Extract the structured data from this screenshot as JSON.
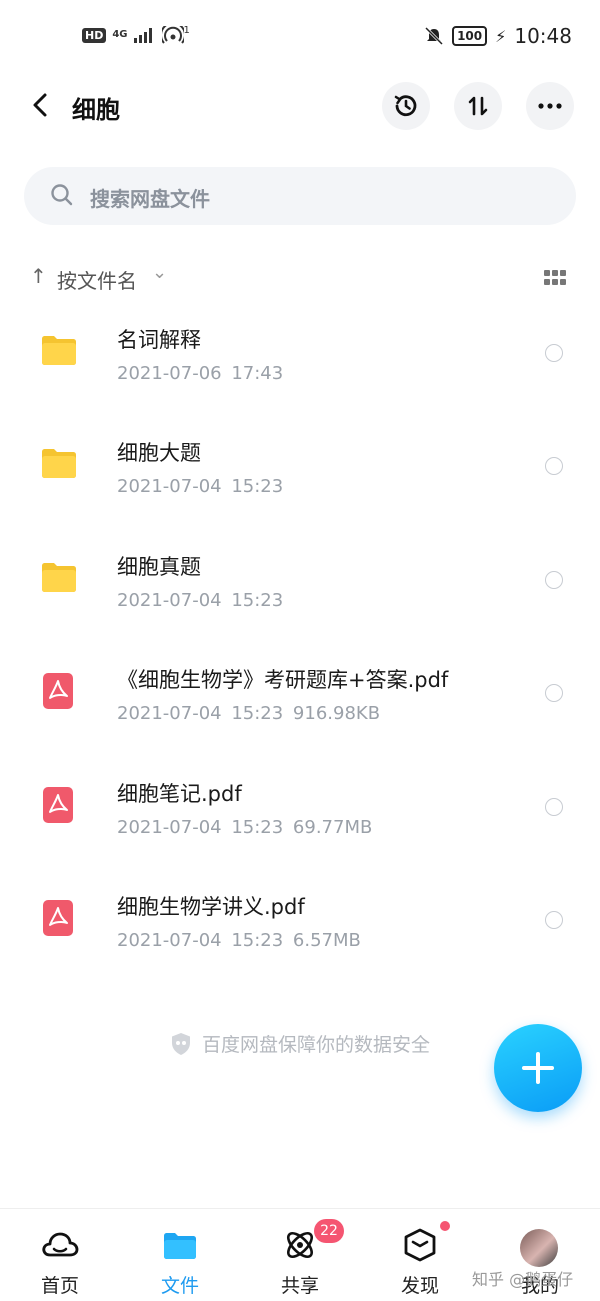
{
  "status_bar": {
    "left_hd": "HD",
    "left_net": "4G",
    "left_hotspot_sup": "1",
    "battery": "100",
    "time": "10:48"
  },
  "header": {
    "title": "细胞"
  },
  "search": {
    "placeholder": "搜索网盘文件"
  },
  "sort": {
    "label": "按文件名"
  },
  "files": [
    {
      "type": "folder",
      "name": "名词解释",
      "meta": "2021-07-06 17:43"
    },
    {
      "type": "folder",
      "name": "细胞大题",
      "meta": "2021-07-04 15:23"
    },
    {
      "type": "folder",
      "name": "细胞真题",
      "meta": "2021-07-04 15:23"
    },
    {
      "type": "pdf",
      "name": "《细胞生物学》考研题库+答案.pdf",
      "meta": "2021-07-04 15:23 916.98KB"
    },
    {
      "type": "pdf",
      "name": "细胞笔记.pdf",
      "meta": "2021-07-04 15:23 69.77MB"
    },
    {
      "type": "pdf",
      "name": "细胞生物学讲义.pdf",
      "meta": "2021-07-04 15:23 6.57MB"
    }
  ],
  "security_text": "百度网盘保障你的数据安全",
  "bottom_nav": {
    "items": [
      {
        "label": "首页",
        "icon": "home-cloud-icon"
      },
      {
        "label": "文件",
        "icon": "folder-icon",
        "active": true
      },
      {
        "label": "共享",
        "icon": "share-orbit-icon",
        "badge": "22"
      },
      {
        "label": "发现",
        "icon": "discover-cube-icon"
      },
      {
        "label": "我的",
        "icon": "avatar"
      }
    ]
  },
  "watermark": "知乎 @鹅蛋仔",
  "colors": {
    "accent": "#1e9bf0",
    "folder": "#ffd54a",
    "pdf": "#f0596b",
    "badge": "#f55571"
  }
}
